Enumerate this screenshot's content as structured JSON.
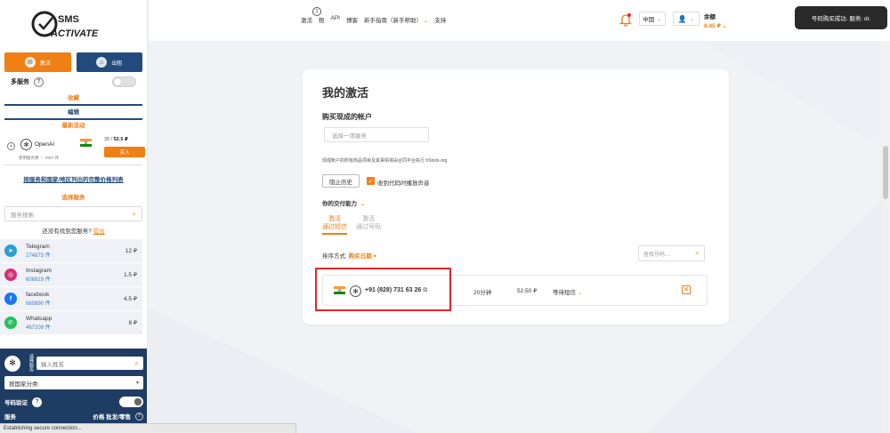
{
  "logo": {
    "line1": "SMS",
    "line2": "ACTIVATE"
  },
  "sidebar": {
    "buy_label": "激活",
    "rent_label": "出租",
    "multi_service_label": "多服务",
    "favorites_label": "收藏",
    "edit_label": "编辑",
    "latest_label": "最新活动",
    "latest_item": {
      "service": "OpenAI",
      "price_prefix": "35 /",
      "price": "52.5 ₽",
      "buy_label": "买入",
      "sub": "使用服务费 ・ 7067 件"
    },
    "full_list_link": "按服务和国家/地区列出的完整价格列表",
    "choose_service_label": "选择服务",
    "search_placeholder": "服务搜索",
    "not_found_text": "还没有找到您服务?",
    "not_found_link": "提出",
    "services": [
      {
        "name": "Telegram",
        "count": "274873 件",
        "price": "12 ₽",
        "icon": "telegram-icon",
        "color": "#2a9fd8"
      },
      {
        "name": "Instagram",
        "count": "606819 件",
        "price": "1.5 ₽",
        "icon": "instagram-icon",
        "color": "#d6307a"
      },
      {
        "name": "facebook",
        "count": "660890 件",
        "price": "4.5 ₽",
        "icon": "facebook-icon",
        "color": "#1877f2"
      },
      {
        "name": "Whatsapp",
        "count": "467209 件",
        "price": "8 ₽",
        "icon": "whatsapp-icon",
        "color": "#25c05d"
      }
    ],
    "panel": {
      "vertical_text": "选择服务",
      "name_placeholder": "输入姓名",
      "country_select": "按国家分类:",
      "verify_label": "号码验证",
      "foot_left": "服务",
      "foot_right": "价格 批发/零售"
    }
  },
  "status_bar": "Establishing secure connection...",
  "header": {
    "nav": [
      "激活",
      "租",
      "API",
      "博客",
      "新手指南（新手帮助）",
      "支持"
    ],
    "nav_badge": "1",
    "lang": "中国",
    "balance_label": "余额",
    "balance_value": "8.45 ₽"
  },
  "toast": "号码购买成功. 服务: dr.",
  "main": {
    "title": "我的激活",
    "buy_ready_label": "购买现成的帐户",
    "choose_service_placeholder": "选择一项服务",
    "note": "现成账户的所有商品项目及其事情将由合同平台执行 hStock.org",
    "history_button": "阻止历史",
    "sound_checkbox_label": "收到代码时播放声音",
    "delivery_label": "你的交付能力",
    "tabs": [
      {
        "line1": "激活",
        "line2": "通过短信"
      },
      {
        "line1": "激活",
        "line2": "通过号码"
      }
    ],
    "sort_label": "排序方式:",
    "sort_value": "购买日期",
    "number_search_placeholder": "查找号码...",
    "order": {
      "phone": "+91 (828) 731 63 26",
      "time": "20分钟",
      "amount": "52.50 ₽",
      "status": "等待短信"
    }
  }
}
